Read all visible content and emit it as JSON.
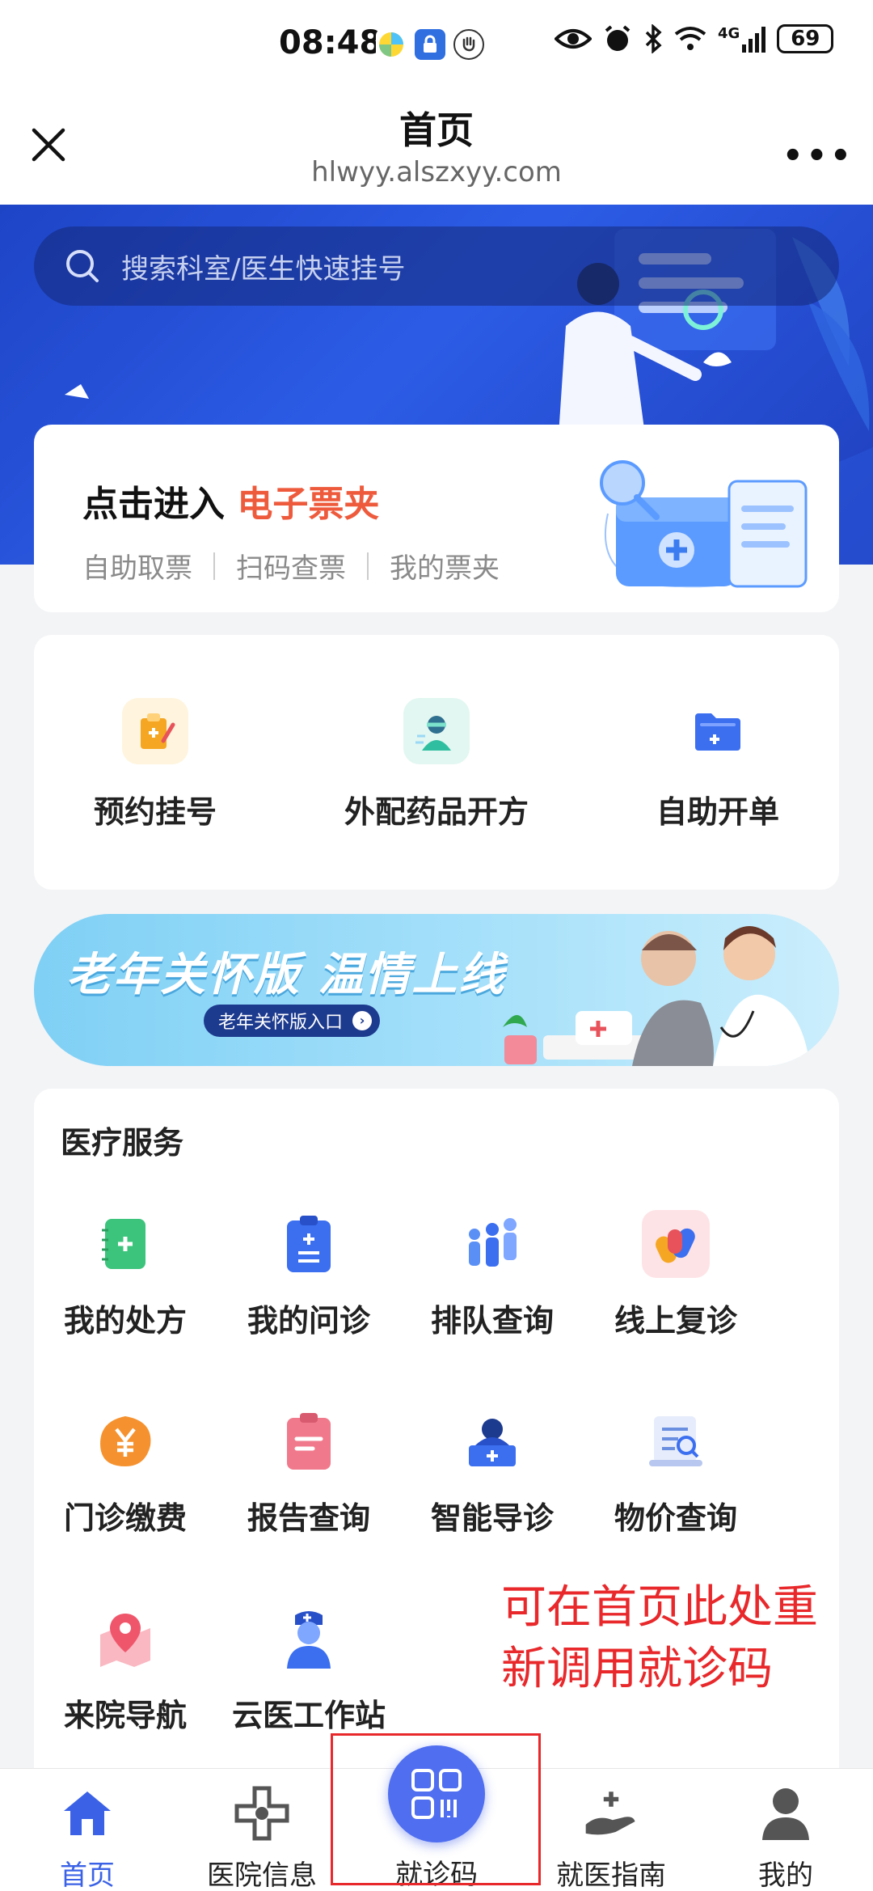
{
  "status_bar": {
    "time": "08:48",
    "network": "4G",
    "battery": "69"
  },
  "titlebar": {
    "title": "首页",
    "url": "hlwyy.alszxyy.com",
    "more": "•••"
  },
  "search": {
    "placeholder": "搜索科室/医生快速挂号"
  },
  "ticket": {
    "title_prefix": "点击进入",
    "title_highlight": "电子票夹",
    "links": [
      "自助取票",
      "扫码查票",
      "我的票夹"
    ]
  },
  "quick_actions": [
    {
      "label": "预约挂号",
      "icon": "clipboard-pen-icon",
      "color": "#f5a623"
    },
    {
      "label": "外配药品开方",
      "icon": "doctor-icon",
      "color": "#2fbfa0"
    },
    {
      "label": "自助开单",
      "icon": "folder-plus-icon",
      "color": "#3b6ff0"
    }
  ],
  "elder_banner": {
    "title": "老年关怀版 温情上线",
    "button": "老年关怀版入口"
  },
  "medical_services": {
    "title": "医疗服务",
    "items": [
      {
        "label": "我的处方",
        "icon": "notebook-plus-icon",
        "color": "#3cc47c"
      },
      {
        "label": "我的问诊",
        "icon": "clipboard-list-icon",
        "color": "#3b6ff0"
      },
      {
        "label": "排队查询",
        "icon": "queue-people-icon",
        "color": "#5a8ff5"
      },
      {
        "label": "线上复诊",
        "icon": "capsule-icon",
        "color": "#e8525a"
      },
      {
        "label": "门诊缴费",
        "icon": "yuan-payment-icon",
        "color": "#f5922f"
      },
      {
        "label": "报告查询",
        "icon": "report-icon",
        "color": "#f07a8c"
      },
      {
        "label": "智能导诊",
        "icon": "guide-desk-icon",
        "color": "#3b6ff0"
      },
      {
        "label": "物价查询",
        "icon": "price-scroll-icon",
        "color": "#6b8fe0"
      },
      {
        "label": "来院导航",
        "icon": "map-pin-icon",
        "color": "#f0566b"
      },
      {
        "label": "云医工作站",
        "icon": "nurse-icon",
        "color": "#3b6ff0"
      }
    ]
  },
  "annotation": {
    "line1": "可在首页此处重",
    "line2": "新调用就诊码"
  },
  "tabbar": {
    "tabs": [
      {
        "label": "首页",
        "icon": "home-icon",
        "active": true
      },
      {
        "label": "医院信息",
        "icon": "hospital-cross-icon",
        "active": false
      },
      {
        "label": "就诊码",
        "icon": "qr-code-icon",
        "active": false
      },
      {
        "label": "就医指南",
        "icon": "hand-care-icon",
        "active": false
      },
      {
        "label": "我的",
        "icon": "user-icon",
        "active": false
      }
    ]
  },
  "colors": {
    "accent": "#3b62e6",
    "highlight": "#ee5a3c",
    "annotation": "#e8282b"
  }
}
